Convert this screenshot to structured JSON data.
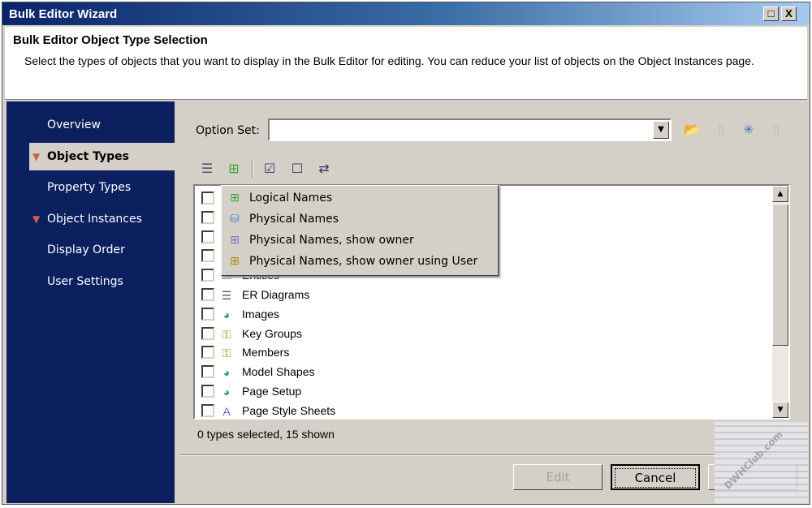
{
  "window": {
    "title": "Bulk Editor Wizard",
    "maximize_label": "□",
    "close_label": "X"
  },
  "header": {
    "title": "Bulk Editor Object Type Selection",
    "description": "Select the types of objects that you want to display in the Bulk Editor for editing. You can reduce your list of objects on the Object Instances page."
  },
  "sidebar": {
    "items": [
      {
        "label": "Overview",
        "active": false,
        "flag": false
      },
      {
        "label": "Object Types",
        "active": true,
        "flag": true
      },
      {
        "label": "Property Types",
        "active": false,
        "flag": false
      },
      {
        "label": "Object Instances",
        "active": false,
        "flag": true
      },
      {
        "label": "Display Order",
        "active": false,
        "flag": false
      },
      {
        "label": "User Settings",
        "active": false,
        "flag": false
      }
    ]
  },
  "option_set": {
    "label": "Option Set:",
    "value": ""
  },
  "option_icons": [
    "open-folder-icon",
    "save-icon",
    "new-icon",
    "delete-icon"
  ],
  "toolbar_icons": [
    "er-diagram-icon",
    "logical-names-dropdown-icon",
    "check-all-icon",
    "uncheck-all-icon",
    "invert-selection-icon"
  ],
  "name_menu": {
    "items": [
      {
        "label": "Logical Names",
        "icon": "logical-names-icon"
      },
      {
        "label": "Physical Names",
        "icon": "physical-names-icon"
      },
      {
        "label": "Physical Names, show owner",
        "icon": "physical-owner-icon"
      },
      {
        "label": "Physical Names, show owner using User",
        "icon": "physical-owner-user-icon"
      }
    ]
  },
  "object_types": {
    "items": [
      {
        "label": "",
        "checked": false
      },
      {
        "label": "",
        "checked": false
      },
      {
        "label": "",
        "checked": false
      },
      {
        "label": "",
        "checked": false
      },
      {
        "label": "Entities",
        "checked": false
      },
      {
        "label": "ER Diagrams",
        "checked": false
      },
      {
        "label": "Images",
        "checked": false
      },
      {
        "label": "Key Groups",
        "checked": false
      },
      {
        "label": "Members",
        "checked": false
      },
      {
        "label": "Model Shapes",
        "checked": false
      },
      {
        "label": "Page Setup",
        "checked": false
      },
      {
        "label": "Page Style Sheets",
        "checked": false
      }
    ]
  },
  "status": "0 types selected, 15 shown",
  "buttons": {
    "edit": "Edit",
    "cancel": "Cancel"
  },
  "watermark": "DWHClub.com"
}
